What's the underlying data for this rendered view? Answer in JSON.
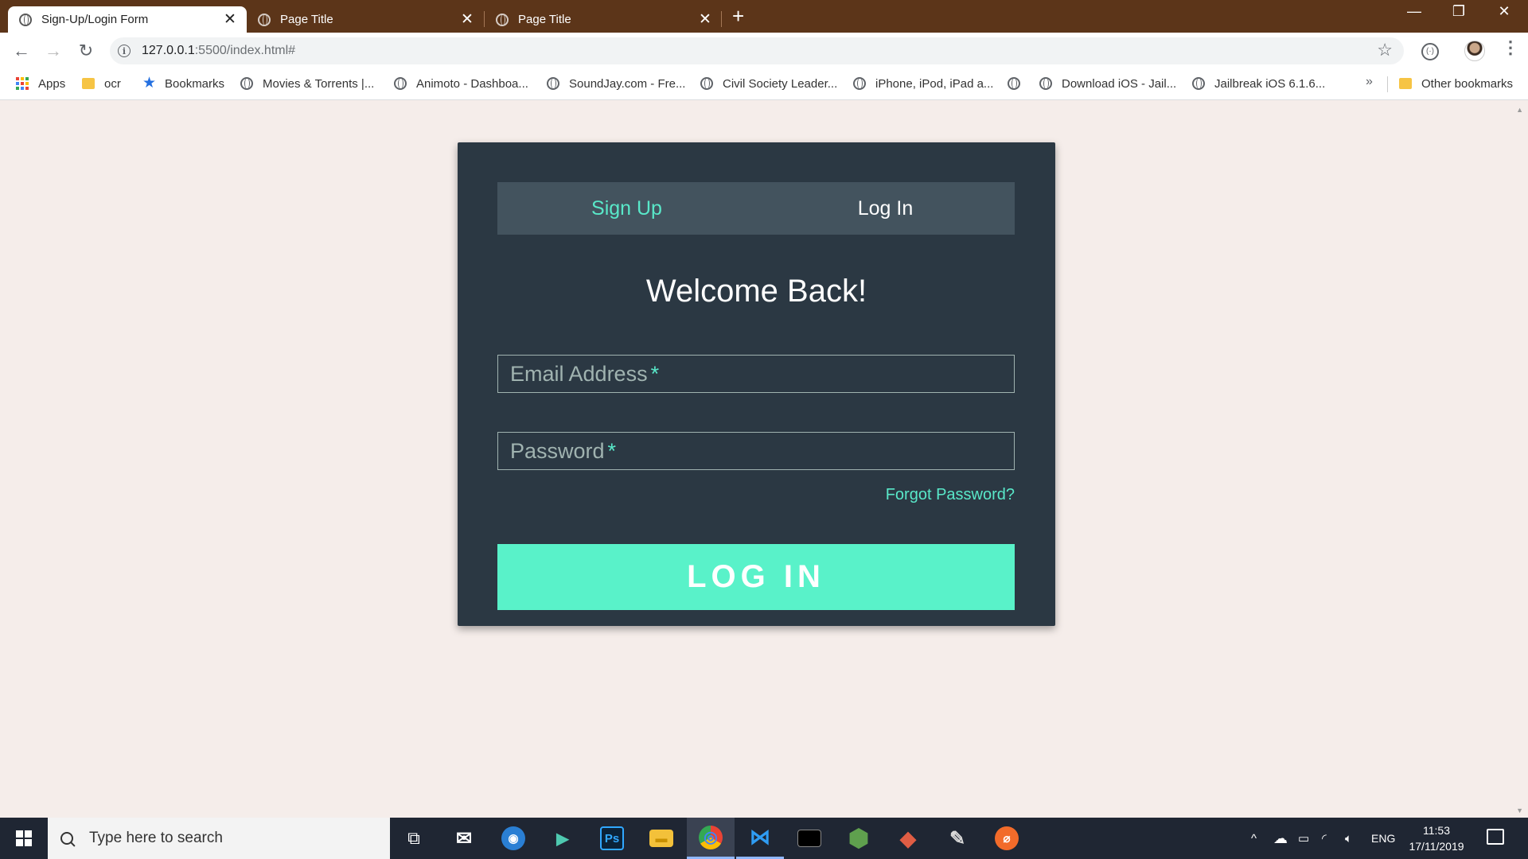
{
  "browser": {
    "tabs": [
      {
        "title": "Sign-Up/Login Form",
        "active": true
      },
      {
        "title": "Page Title",
        "active": false
      },
      {
        "title": "Page Title",
        "active": false
      }
    ],
    "close_glyph": "✕",
    "new_tab_glyph": "+",
    "window_controls": {
      "minimize": "—",
      "restore": "❐",
      "close": "✕"
    },
    "nav": {
      "back": "←",
      "forward": "→",
      "reload": "↻"
    },
    "url": {
      "host": "127.0.0.1",
      "path": ":5500/index.html#"
    },
    "star_glyph": "☆",
    "menu_glyph": "⋮"
  },
  "bookmarks": [
    {
      "label": "Apps",
      "icon": "apps-icon"
    },
    {
      "label": "ocr",
      "icon": "folder-icon"
    },
    {
      "label": "Bookmarks",
      "icon": "star-icon"
    },
    {
      "label": "Movies & Torrents |...",
      "icon": "globe-icon"
    },
    {
      "label": "Animoto - Dashboa...",
      "icon": "globe-icon"
    },
    {
      "label": "SoundJay.com - Fre...",
      "icon": "globe-icon"
    },
    {
      "label": "Civil Society Leader...",
      "icon": "globe-icon"
    },
    {
      "label": "iPhone, iPod, iPad a...",
      "icon": "globe-icon"
    },
    {
      "label": "",
      "icon": "globe-icon"
    },
    {
      "label": "Download iOS - Jail...",
      "icon": "globe-icon"
    },
    {
      "label": "Jailbreak iOS 6.1.6...",
      "icon": "globe-icon"
    }
  ],
  "bookmarks_more": "»",
  "other_bookmarks": "Other bookmarks",
  "form": {
    "tab_signup": "Sign Up",
    "tab_login": "Log In",
    "heading": "Welcome Back!",
    "email_placeholder": "Email Address",
    "password_placeholder": "Password",
    "required_mark": "*",
    "forgot_link": "Forgot Password?",
    "submit_label": "LOG IN"
  },
  "colors": {
    "accent": "#59e8c9",
    "button": "#59f2c9",
    "card": "#2b3843",
    "tab_bar": "#43535e",
    "page_bg": "#f5edea",
    "chrome_frame": "#5c3519"
  },
  "taskbar": {
    "search_placeholder": "Type here to search",
    "apps": [
      {
        "name": "task-view",
        "glyph": "⧉"
      },
      {
        "name": "mail",
        "glyph": "✉"
      },
      {
        "name": "thunderbird",
        "glyph": "◉"
      },
      {
        "name": "sublime",
        "glyph": "▶"
      },
      {
        "name": "photoshop",
        "glyph": "Ps"
      },
      {
        "name": "file-explorer",
        "glyph": "▬"
      },
      {
        "name": "chrome",
        "glyph": "◎"
      },
      {
        "name": "vscode",
        "glyph": "⋈"
      },
      {
        "name": "terminal",
        "glyph": "▭"
      },
      {
        "name": "nodejs",
        "glyph": "⬢"
      },
      {
        "name": "git",
        "glyph": "◆"
      },
      {
        "name": "paint",
        "glyph": "✎"
      },
      {
        "name": "app-orange",
        "glyph": "⌀"
      }
    ],
    "language": "ENG",
    "time": "11:53",
    "date": "17/11/2019"
  }
}
